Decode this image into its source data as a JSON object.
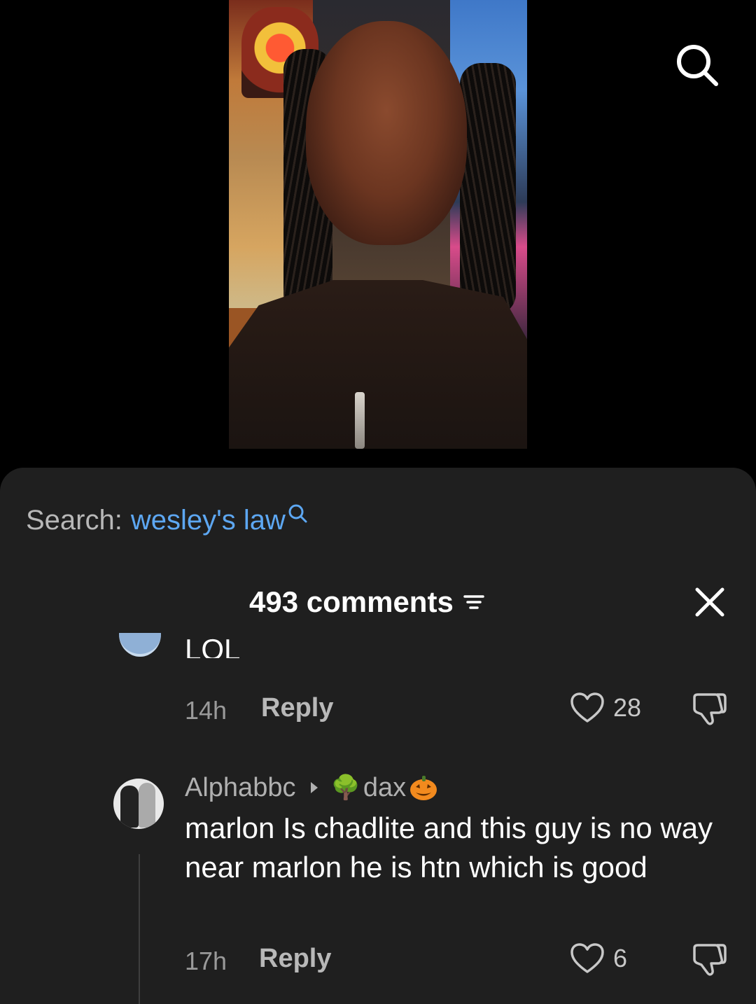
{
  "search": {
    "prefix": "Search:",
    "term": "wesley's law"
  },
  "comments_header": {
    "title": "493 comments"
  },
  "comments": [
    {
      "text": "LOL",
      "time": "14h",
      "reply_label": "Reply",
      "likes": "28"
    },
    {
      "username": "Alphabbc",
      "reply_to": "dax",
      "reply_to_prefix_emoji": "🌳",
      "text": "marlon Is chadlite and this guy is no way near marlon he is htn which is good",
      "time": "17h",
      "reply_label": "Reply",
      "likes": "6"
    }
  ],
  "colors": {
    "sheet_background": "#1f1f1f",
    "search_term": "#5da7f2",
    "muted_text": "#9a9a9a"
  },
  "icons": [
    "search-icon",
    "sort-icon",
    "close-icon",
    "heart-icon",
    "dislike-icon",
    "caret-right-icon",
    "pumpkin-icon"
  ]
}
